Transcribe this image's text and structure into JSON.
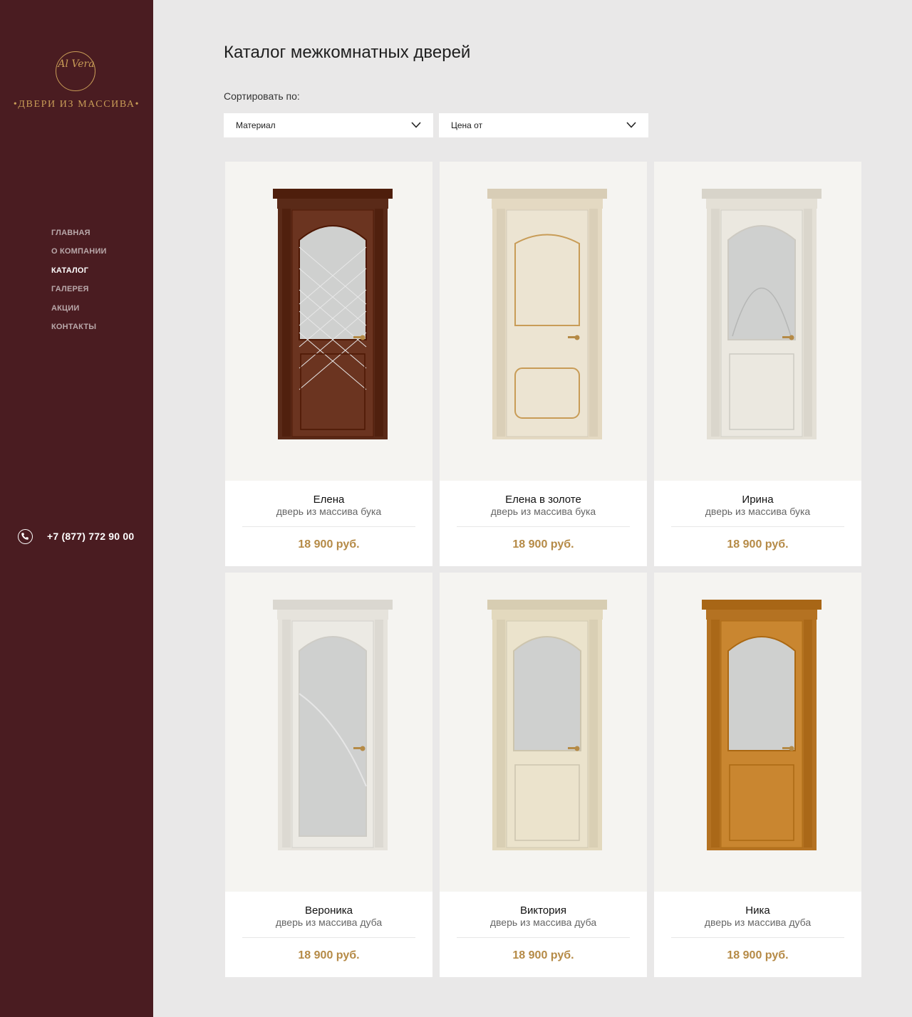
{
  "brand": {
    "logo_script": "Al Vera",
    "tagline": "•ДВЕРИ ИЗ МАССИВА•",
    "gold_color": "#c89c57"
  },
  "nav": {
    "items": [
      {
        "label": "ГЛАВНАЯ",
        "active": false
      },
      {
        "label": "О КОМПАНИИ",
        "active": false
      },
      {
        "label": "КАТАЛОГ",
        "active": true
      },
      {
        "label": "ГАЛЕРЕЯ",
        "active": false
      },
      {
        "label": "АКЦИИ",
        "active": false
      },
      {
        "label": "КОНТАКТЫ",
        "active": false
      }
    ]
  },
  "contact": {
    "phone": "+7 (877) 772 90 00",
    "icon": "phone-icon"
  },
  "main": {
    "title": "Каталог межкомнатных дверей",
    "sort_label": "Сортировать по:",
    "filters": [
      {
        "label": "Материал",
        "icon": "chevron-down-icon"
      },
      {
        "label": "Цена от",
        "icon": "chevron-down-icon"
      }
    ]
  },
  "products": [
    {
      "name": "Елена",
      "material": "дверь из массива бука",
      "price": "18 900 руб.",
      "door_color": "#6b3420",
      "frame_color": "#5a2a18",
      "glass": true,
      "glass_pattern": "diamond"
    },
    {
      "name": "Елена в золоте",
      "material": "дверь из массива бука",
      "price": "18 900 руб.",
      "door_color": "#ece4d2",
      "frame_color": "#e4d9c2",
      "glass": false,
      "glass_pattern": "none"
    },
    {
      "name": "Ирина",
      "material": "дверь из массива бука",
      "price": "18 900 руб.",
      "door_color": "#ebe8e0",
      "frame_color": "#e4e0d6",
      "glass": true,
      "glass_pattern": "arch"
    },
    {
      "name": "Вероника",
      "material": "дверь из массива дуба",
      "price": "18 900 руб.",
      "door_color": "#eceae4",
      "frame_color": "#e6e3dc",
      "glass": true,
      "glass_pattern": "full"
    },
    {
      "name": "Виктория",
      "material": "дверь из массива дуба",
      "price": "18 900 руб.",
      "door_color": "#ebe3cc",
      "frame_color": "#e3d9be",
      "glass": true,
      "glass_pattern": "plain"
    },
    {
      "name": "Ника",
      "material": "дверь из массива дуба",
      "price": "18 900 руб.",
      "door_color": "#c98630",
      "frame_color": "#b47222",
      "glass": true,
      "glass_pattern": "plain"
    }
  ]
}
